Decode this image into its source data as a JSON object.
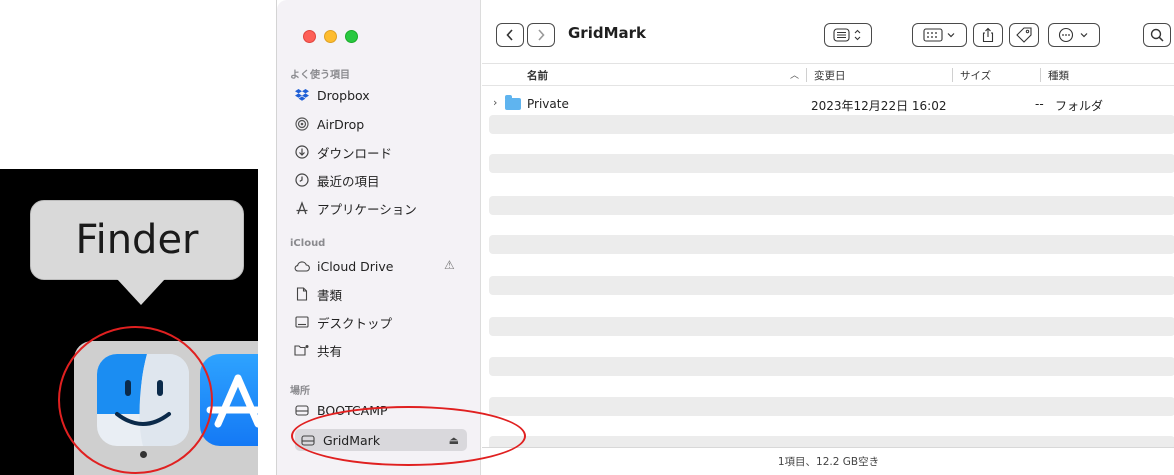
{
  "dock": {
    "tooltip": "Finder",
    "finder_icon": "finder-face-icon",
    "appstore_icon": "app-store-icon",
    "highlight_color": "#e02020"
  },
  "window": {
    "title": "GridMark",
    "toolbar": {
      "back_icon": "chevron-left-icon",
      "forward_icon": "chevron-right-icon",
      "view_icon": "list-view-icon",
      "group_icon": "group-icon",
      "share_icon": "share-icon",
      "tag_icon": "tag-icon",
      "more_icon": "ellipsis-circle-icon",
      "search_icon": "search-icon"
    },
    "sidebar": {
      "favorites_heading": "よく使う項目",
      "favorites": [
        {
          "label": "Dropbox",
          "icon": "dropbox-icon"
        },
        {
          "label": "AirDrop",
          "icon": "airdrop-icon"
        },
        {
          "label": "ダウンロード",
          "icon": "download-icon"
        },
        {
          "label": "最近の項目",
          "icon": "clock-icon"
        },
        {
          "label": "アプリケーション",
          "icon": "applications-icon"
        }
      ],
      "icloud_heading": "iCloud",
      "icloud": [
        {
          "label": "iCloud Drive",
          "icon": "cloud-icon"
        },
        {
          "label": "書類",
          "icon": "document-icon"
        },
        {
          "label": "デスクトップ",
          "icon": "desktop-icon"
        },
        {
          "label": "共有",
          "icon": "shared-folder-icon"
        }
      ],
      "locations_heading": "場所",
      "locations": [
        {
          "label": "BOOTCAMP",
          "icon": "drive-icon"
        },
        {
          "label": "GridMark",
          "icon": "drive-icon",
          "selected": true
        }
      ]
    },
    "columns": {
      "name": "名前",
      "date": "変更日",
      "size": "サイズ",
      "kind": "種類"
    },
    "files": [
      {
        "name": "Private",
        "date": "2023年12月22日 16:02",
        "size": "--",
        "kind": "フォルダ"
      }
    ],
    "status": "1項目、12.2 GB空き"
  }
}
